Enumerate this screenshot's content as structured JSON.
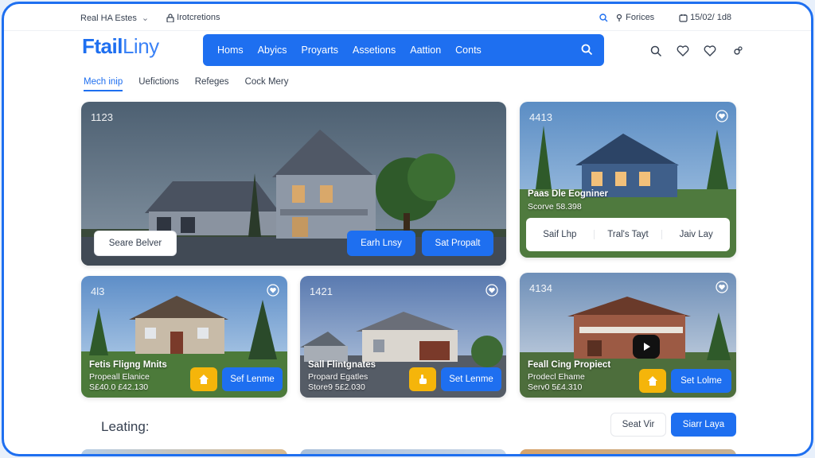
{
  "util_bar": {
    "site": "Real HA Estes",
    "notifications": "Irotcretions",
    "forces": "Forices",
    "date": "15/02/ 1d8"
  },
  "logo": {
    "strong": "Ftail",
    "light": "Liny"
  },
  "main_nav": [
    "Homs",
    "Abyics",
    "Proyarts",
    "Assetions",
    "Aattion",
    "Conts"
  ],
  "sub_tabs": [
    {
      "label": "Mech inip",
      "active": true
    },
    {
      "label": "Uefictions",
      "active": false
    },
    {
      "label": "Refeges",
      "active": false
    },
    {
      "label": "Cock Mery",
      "active": false
    }
  ],
  "hero": {
    "number": "1123",
    "search_btn": "Seare Belver",
    "btn1": "Earh Lnsy",
    "btn2": "Sat Propalt"
  },
  "right_card": {
    "number": "4413",
    "title": "Paas Dle Eogniner",
    "subtitle": "Scorve 58.398",
    "segments": [
      "Saif Lhp",
      "Tral's Tayt",
      "Jaiv Lay"
    ]
  },
  "cards": [
    {
      "number": "4l3",
      "title": "Fetis Fligng Mnits",
      "line2": "Propeall Elanice",
      "line3": "S£40.0 £42.130",
      "btn": "Sef Lenme"
    },
    {
      "number": "1421",
      "title": "Sall Flintgnates",
      "line2": "Propard Egatles",
      "line3": "Store9 5£2.030",
      "btn": "Set Lenme"
    },
    {
      "number": "4134",
      "title": "Feall Cing Propiect",
      "line2": "Prodecl Ehame",
      "line3": "Serv0 5£4.310",
      "btn": "Set Lolme"
    }
  ],
  "bottom": {
    "heading": "Leating:",
    "btn_white": "Seat Vir",
    "btn_blue": "Siarr Laya"
  },
  "colors": {
    "accent": "#1e6ff0",
    "yellow": "#f5b50a"
  }
}
